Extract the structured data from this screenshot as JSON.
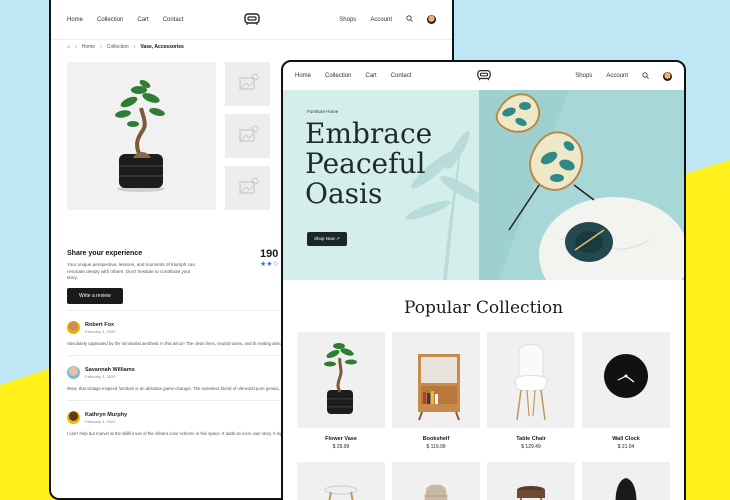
{
  "colors": {
    "accent": "#1a1a1a",
    "sky": "#bfe6f4",
    "yellow": "#ffef1a",
    "hero": "#d4eeec",
    "star": "#3f6fd6"
  },
  "back": {
    "nav": {
      "links": [
        "Home",
        "Collection",
        "Cart",
        "Contact"
      ],
      "right": [
        "Shops",
        "Account"
      ]
    },
    "breadcrumb": {
      "home_icon": "home-icon",
      "items": [
        "Home",
        "Collection"
      ],
      "current": "Vase, Accessories"
    },
    "review_section": {
      "title": "Share your experience",
      "text": "Your unique perspective, lessons, and moments of triumph can resonate deeply with others. Don't hesitate to contribute your story.",
      "button": "Write a review"
    },
    "rating": {
      "count": "190 R",
      "stars": "★★☆"
    },
    "reviews": [
      {
        "name": "Robert Fox",
        "date": "February 3, 2020",
        "body": "Absolutely captivated by the minimalist aesthetic in this décor! The clean lines, neutral tones, and th inviting atmosphere that's hard to resist."
      },
      {
        "name": "Savannah Williams",
        "date": "February 3, 2020",
        "body": "Wow, that vintage-inspired furniture is an absolute game-changer. The seamless blend of old-world pure genius, bringing a unique character that immediately catches the eye."
      },
      {
        "name": "Kathryn Murphy",
        "date": "February 3, 2020",
        "body": "I can't help but marvel at the skillful use of the vibrant color scheme in this space. It adds an incre own story. It injects so much personality into the room that I'm been inspired to try something simila"
      }
    ]
  },
  "front": {
    "nav": {
      "links": [
        "Home",
        "Collection",
        "Cart",
        "Contact"
      ],
      "right": [
        "Shops",
        "Account"
      ]
    },
    "hero": {
      "small": "Furniture Home",
      "title_lines": [
        "Embrace",
        "Peaceful",
        "Oasis"
      ],
      "button": "Shop Now ↗"
    },
    "popular": {
      "title": "Popular Collection"
    },
    "products": [
      {
        "name": "Flower Vase",
        "price": "$ 29.99"
      },
      {
        "name": "Bookshelf",
        "price": "$ 119.99"
      },
      {
        "name": "Table Chair",
        "price": "$ 129.49"
      },
      {
        "name": "Wall Clock",
        "price": "$ 21.04"
      }
    ]
  }
}
